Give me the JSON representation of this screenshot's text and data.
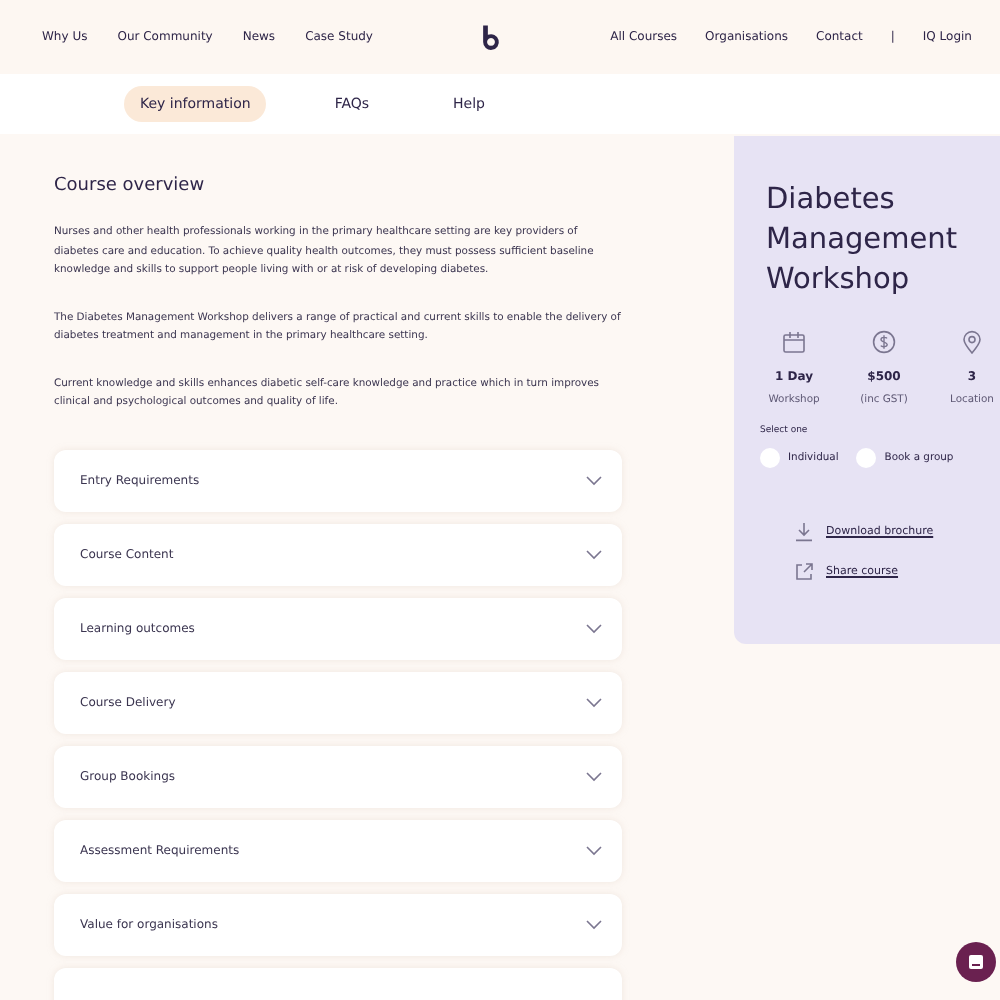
{
  "nav_left": [
    "Why Us",
    "Our Community",
    "News",
    "Case Study"
  ],
  "nav_right": [
    "All Courses",
    "Organisations",
    "Contact",
    "|",
    "IQ Login"
  ],
  "tabs": [
    {
      "label": "Key information",
      "selected": true
    },
    {
      "label": "FAQs",
      "selected": false
    },
    {
      "label": "Help",
      "selected": false
    }
  ],
  "overview": {
    "heading": "Course overview",
    "paragraphs": [
      "Nurses and other health professionals working in the primary healthcare setting are key providers of diabetes care and education. To achieve quality health outcomes, they must possess sufficient baseline knowledge and skills to support people living with or at risk of developing diabetes.",
      "The Diabetes Management Workshop delivers a range of practical and current skills to enable the delivery of diabetes treatment and management in the primary healthcare setting.",
      "Current knowledge and skills enhances diabetic self-care knowledge and practice which in turn improves clinical and psychological outcomes and quality of life."
    ]
  },
  "accordion": [
    {
      "title": "Entry Requirements",
      "expanded": false
    },
    {
      "title": "Course Content",
      "expanded": false
    },
    {
      "title": "Learning outcomes",
      "expanded": false
    },
    {
      "title": "Course Delivery",
      "expanded": false
    },
    {
      "title": "Group Bookings",
      "expanded": false
    },
    {
      "title": "Assessment Requirements",
      "expanded": false
    },
    {
      "title": "Value for organisations",
      "expanded": false
    }
  ],
  "course_card": {
    "title": "Diabetes Management Workshop",
    "stats": [
      {
        "kind": "calendar",
        "value": "1 Day",
        "label": "Workshop"
      },
      {
        "kind": "dollar",
        "value": "$500",
        "label": "(inc GST)"
      },
      {
        "kind": "pin",
        "value": "3",
        "label": "Location"
      }
    ],
    "select_label": "Select one",
    "options": [
      {
        "label": "Individual",
        "selected": false
      },
      {
        "label": "Book a group",
        "selected": false
      }
    ],
    "links": [
      {
        "kind": "download",
        "label": "Download brochure"
      },
      {
        "kind": "share",
        "label": "Share course"
      }
    ]
  }
}
